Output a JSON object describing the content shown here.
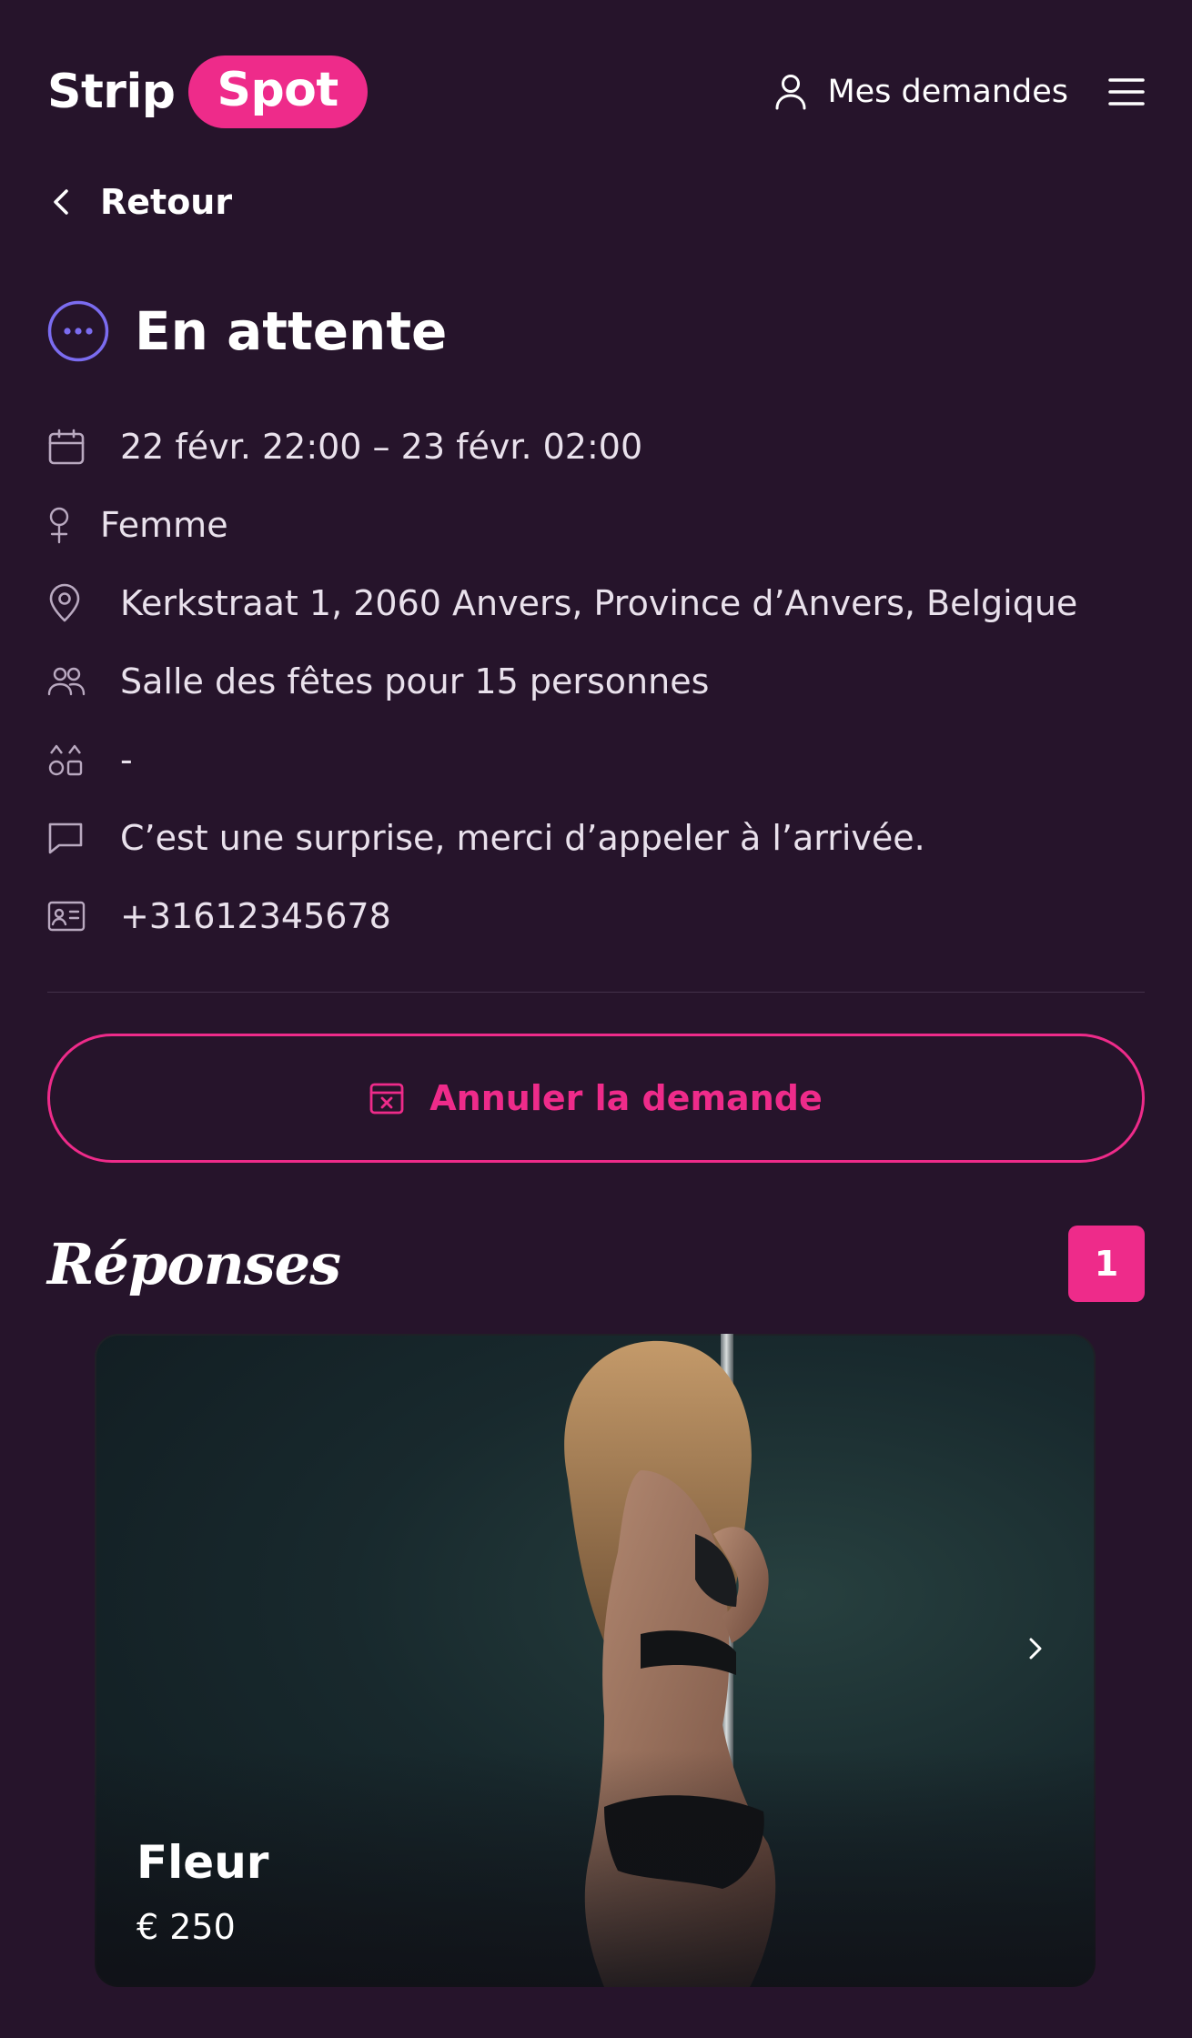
{
  "header": {
    "logo_part1": "Strip",
    "logo_part2": "Spot",
    "my_requests_label": "Mes demandes"
  },
  "back_label": "Retour",
  "status": {
    "title": "En attente"
  },
  "details": {
    "datetime": "22 févr. 22:00 – 23 févr. 02:00",
    "gender": "Femme",
    "address": "Kerkstraat 1, 2060 Anvers, Province d’Anvers, Belgique",
    "venue": "Salle des fêtes pour 15 personnes",
    "extras": "-",
    "comment": "C’est une surprise, merci d’appeler à l’arrivée.",
    "phone": "+31612345678"
  },
  "cancel_label": "Annuler la demande",
  "responses": {
    "title": "Réponses",
    "count": "1",
    "items": [
      {
        "name": "Fleur",
        "price": "€ 250"
      }
    ]
  },
  "colors": {
    "background": "#26142b",
    "accent": "#ee2b8a",
    "status_icon": "#7b6cf0"
  }
}
